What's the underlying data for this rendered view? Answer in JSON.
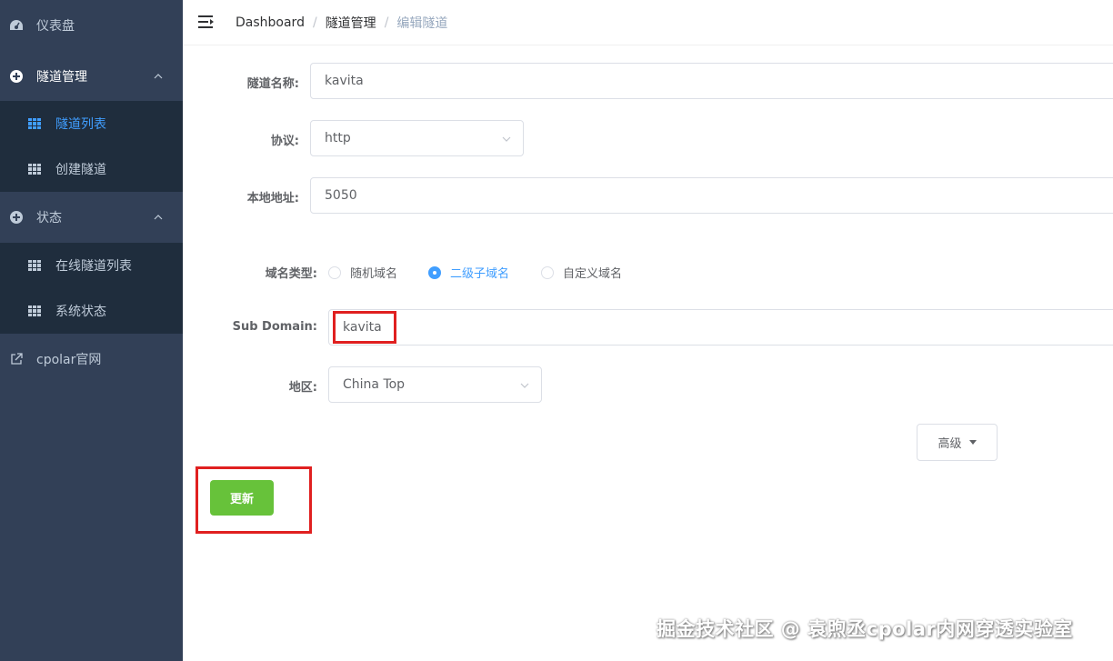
{
  "sidebar": {
    "dashboard": {
      "label": "仪表盘",
      "icon": "dashboard-icon"
    },
    "tunnel_mgmt": {
      "label": "隧道管理",
      "icon": "plus-circle-icon"
    },
    "tunnel_list": {
      "label": "隧道列表",
      "icon": "grid-icon"
    },
    "create_tunnel": {
      "label": "创建隧道",
      "icon": "grid-icon"
    },
    "status": {
      "label": "状态",
      "icon": "plus-circle-icon"
    },
    "online_tunnels": {
      "label": "在线隧道列表",
      "icon": "grid-icon"
    },
    "system_status": {
      "label": "系统状态",
      "icon": "grid-icon"
    },
    "website": {
      "label": "cpolar官网",
      "icon": "external-link-icon"
    }
  },
  "breadcrumb": {
    "items": [
      "Dashboard",
      "隧道管理",
      "编辑隧道"
    ],
    "separator": "/"
  },
  "form": {
    "tunnel_name": {
      "label": "隧道名称:",
      "value": "kavita"
    },
    "protocol": {
      "label": "协议:",
      "value": "http"
    },
    "local_address": {
      "label": "本地地址:",
      "value": "5050"
    },
    "domain_type": {
      "label": "域名类型:",
      "options": [
        "随机域名",
        "二级子域名",
        "自定义域名"
      ],
      "selected": "二级子域名"
    },
    "sub_domain": {
      "label": "Sub Domain:",
      "value": "kavita"
    },
    "region": {
      "label": "地区:",
      "value": "China Top"
    }
  },
  "buttons": {
    "advanced": "高级",
    "update": "更新"
  },
  "watermark": "掘金技术社区 @ 袁煦丞cpolar内网穿透实验室",
  "colors": {
    "sidebar_bg": "#324057",
    "submenu_bg": "#1f2d3d",
    "active": "#409eff",
    "success": "#67c23a",
    "highlight": "#e02020"
  }
}
